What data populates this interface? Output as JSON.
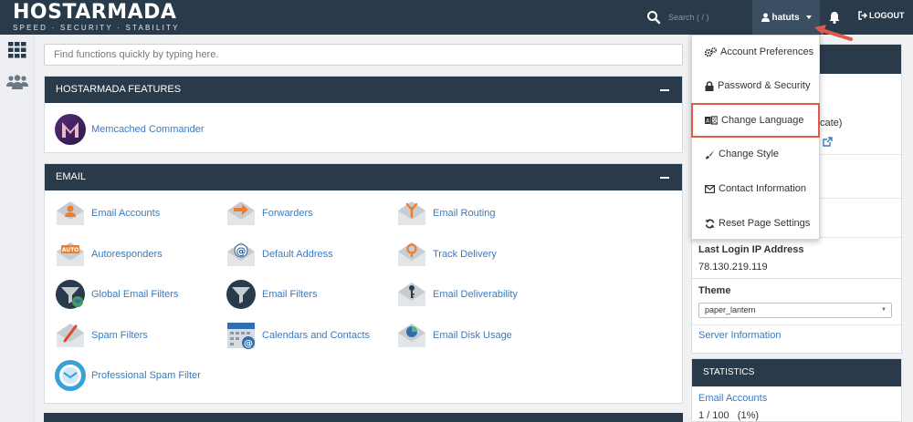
{
  "brand": {
    "name": "HOSTARMADA",
    "tagline": "SPEED · SECURITY · STABILITY"
  },
  "topbar": {
    "search_placeholder": "Search ( / )",
    "username": "hatuts",
    "logout_label": "LOGOUT"
  },
  "function_search": {
    "placeholder": "Find functions quickly by typing here."
  },
  "features_panel": {
    "title": "HOSTARMADA FEATURES",
    "items": [
      {
        "label": "Memcached Commander",
        "icon": "memcached-icon"
      }
    ]
  },
  "email_panel": {
    "title": "EMAIL",
    "items": [
      {
        "label": "Email Accounts",
        "icon": "email-accounts-icon"
      },
      {
        "label": "Forwarders",
        "icon": "forwarders-icon"
      },
      {
        "label": "Email Routing",
        "icon": "email-routing-icon"
      },
      {
        "label": "Autoresponders",
        "icon": "autoresponders-icon"
      },
      {
        "label": "Default Address",
        "icon": "default-address-icon"
      },
      {
        "label": "Track Delivery",
        "icon": "track-delivery-icon"
      },
      {
        "label": "Global Email Filters",
        "icon": "global-filters-icon"
      },
      {
        "label": "Email Filters",
        "icon": "email-filters-icon"
      },
      {
        "label": "Email Deliverability",
        "icon": "deliverability-icon"
      },
      {
        "label": "Spam Filters",
        "icon": "spam-filters-icon"
      },
      {
        "label": "Calendars and Contacts",
        "icon": "calendars-icon"
      },
      {
        "label": "Email Disk Usage",
        "icon": "disk-usage-icon"
      },
      {
        "label": "Professional Spam Filter",
        "icon": "pro-spam-icon"
      }
    ]
  },
  "user_menu": {
    "items": [
      {
        "label": "Account Preferences",
        "icon": "cogs-icon"
      },
      {
        "label": "Password & Security",
        "icon": "lock-icon"
      },
      {
        "label": "Change Language",
        "icon": "language-icon"
      },
      {
        "label": "Change Style",
        "icon": "brush-icon"
      },
      {
        "label": "Contact Information",
        "icon": "envelope-icon"
      },
      {
        "label": "Reset Page Settings",
        "icon": "refresh-icon"
      }
    ]
  },
  "general_info": {
    "partial_text": "cate)",
    "last_login_label": "Last Login IP Address",
    "last_login_value": "78.130.219.119",
    "theme_label": "Theme",
    "theme_value": "paper_lantern",
    "server_info_link": "Server Information"
  },
  "statistics": {
    "title": "STATISTICS",
    "email_accounts_label": "Email Accounts",
    "email_accounts_value": "1 / 100   (1%)"
  },
  "colors": {
    "navy": "#293a4a",
    "link": "#3a7bbf",
    "highlight": "#e05a4b"
  }
}
